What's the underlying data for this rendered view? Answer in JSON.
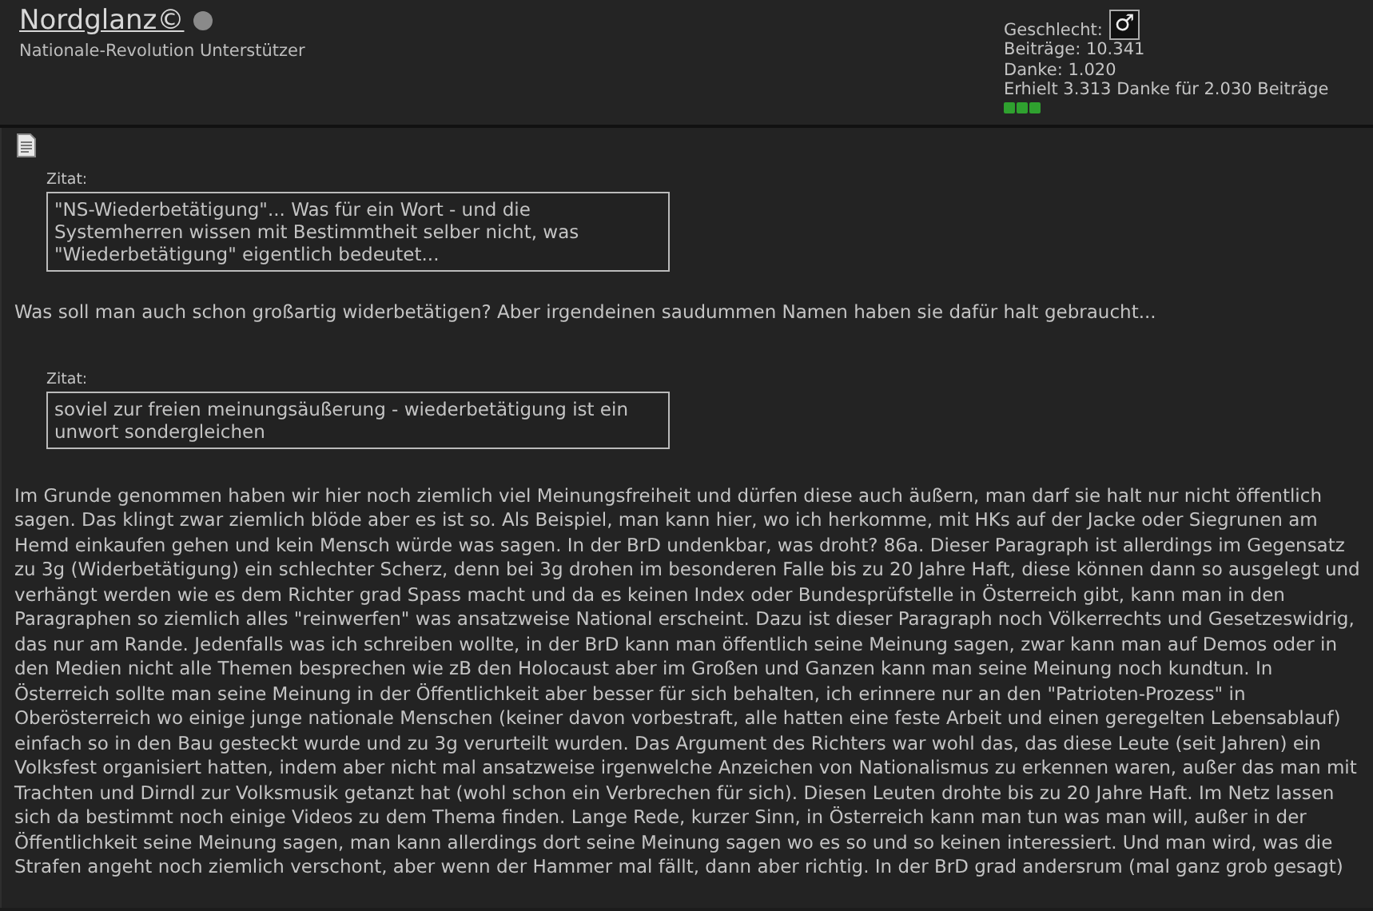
{
  "user": {
    "name": "Nordglanz©",
    "online": false,
    "rank": "Nationale-Revolution Unterstützer"
  },
  "user_info": {
    "gender_label": "Geschlecht:",
    "gender_symbol": "♂",
    "posts": "Beiträge: 10.341",
    "thanks": "Danke: 1.020",
    "received": "Erhielt 3.313 Danke für 2.030 Beiträge"
  },
  "post": {
    "blocks": [
      {
        "kind": "quote",
        "label": "Zitat:",
        "text": "\"NS-Wiederbetätigung\"... Was für ein Wort - und die Systemherren wissen mit Bestimmtheit selber nicht, was \"Wiederbetätigung\" eigentlich bedeutet..."
      },
      {
        "kind": "text",
        "text": "Was soll man auch schon großartig widerbetätigen? Aber irgendeinen saudummen Namen haben sie dafür halt gebraucht..."
      },
      {
        "kind": "quote",
        "label": "Zitat:",
        "text": "soviel zur freien meinungsäußerung - wiederbetätigung ist ein unwort sondergleichen"
      },
      {
        "kind": "text",
        "text": "Im Grunde genommen haben wir hier noch ziemlich viel Meinungsfreiheit und dürfen diese auch äußern, man darf sie halt nur nicht öffentlich sagen. Das klingt zwar ziemlich blöde aber es ist so. Als Beispiel, man kann hier, wo ich herkomme, mit HKs auf der Jacke oder Siegrunen am Hemd einkaufen gehen und kein Mensch würde was sagen. In der BrD undenkbar, was droht? 86a. Dieser Paragraph ist allerdings im Gegensatz zu 3g (Widerbetätigung) ein schlechter Scherz, denn bei 3g drohen im besonderen Falle bis zu 20 Jahre Haft, diese können dann so ausgelegt und verhängt werden wie es dem Richter grad Spass macht und da es keinen Index oder Bundesprüfstelle in Österreich gibt, kann man in den Paragraphen so ziemlich alles \"reinwerfen\" was ansatzweise National erscheint. Dazu ist dieser Paragraph noch Völkerrechts und Gesetzeswidrig, das nur am Rande. Jedenfalls was ich schreiben wollte, in der BrD kann man öffentlich seine Meinung sagen, zwar kann man auf Demos oder in den Medien nicht alle Themen besprechen wie zB den Holocaust aber im Großen und Ganzen kann man seine Meinung noch kundtun. In Österreich sollte man seine Meinung in der Öffentlichkeit aber besser für sich behalten, ich erinnere nur an den \"Patrioten-Prozess\" in Oberösterreich wo einige junge nationale Menschen (keiner davon vorbestraft, alle hatten eine feste Arbeit und einen geregelten Lebensablauf) einfach so in den Bau gesteckt wurde und zu 3g verurteilt wurden. Das Argument des Richters war wohl das, das diese Leute (seit Jahren) ein Volksfest organisiert hatten, indem aber nicht mal ansatzweise irgenwelche Anzeichen von Nationalismus zu erkennen waren, außer das man mit Trachten und Dirndl zur Volksmusik getanzt hat (wohl schon ein Verbrechen für sich). Diesen Leuten drohte bis zu 20 Jahre Haft. Im Netz lassen sich da bestimmt noch einige Videos zu dem Thema finden. Lange Rede, kurzer Sinn, in Österreich kann man tun was man will, außer in der Öffentlichkeit seine Meinung sagen, man kann allerdings dort seine Meinung sagen wo es so und so keinen interessiert. Und man wird, was die Strafen angeht noch ziemlich verschont, aber wenn der Hammer mal fällt, dann aber richtig. In der BrD grad andersrum (mal ganz grob gesagt)"
      }
    ]
  }
}
